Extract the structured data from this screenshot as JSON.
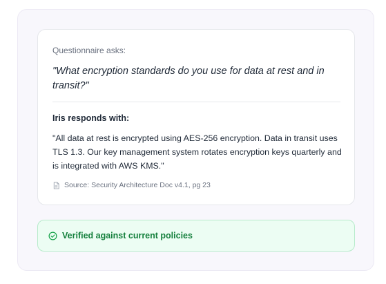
{
  "colors": {
    "accent_green": "#15803d",
    "verified_bg": "#ecfdf3",
    "muted_text": "#6b7280"
  },
  "card": {
    "question_label": "Questionnaire asks:",
    "question": "\"What encryption standards do you use for data at rest and in transit?\"",
    "response_label": "Iris responds with:",
    "answer": "\"All data at rest is encrypted using AES-256 encryption. Data in transit uses TLS 1.3. Our key management system rotates encryption keys quarterly and is integrated with AWS KMS.\"",
    "source_icon": "document-icon",
    "source": "Source: Security Architecture Doc v4.1, pg 23"
  },
  "status": {
    "icon": "check-circle-icon",
    "text": "Verified against current policies"
  }
}
